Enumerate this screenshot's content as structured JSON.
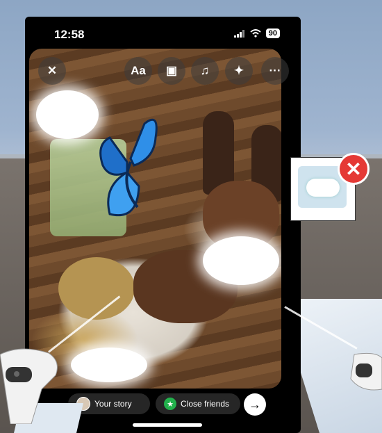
{
  "status_bar": {
    "time": "12:58",
    "battery": "90"
  },
  "top_controls": {
    "close_glyph": "✕",
    "text_label": "Aa",
    "sticker_glyph": "▣",
    "music_glyph": "♫",
    "effects_glyph": "✦",
    "more_glyph": "···"
  },
  "bottom_bar": {
    "your_story": "Your story",
    "close_friends": "Close friends",
    "next_glyph": "→"
  },
  "side_panel": {
    "close_glyph": "✕"
  },
  "colors": {
    "close_red": "#e53935",
    "close_friends_green": "#22b14c",
    "butterfly_blue": "#2f8fe8"
  }
}
